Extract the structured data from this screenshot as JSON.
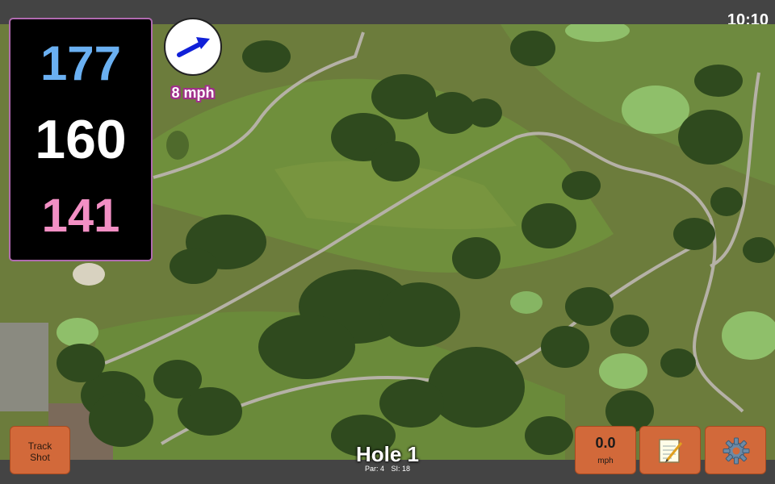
{
  "status": {
    "time": "10:10"
  },
  "distances": {
    "back": "177",
    "middle": "160",
    "front": "141"
  },
  "wind": {
    "speed_label": "8 mph",
    "direction_icon": "arrow-right-icon"
  },
  "hole": {
    "title": "Hole 1",
    "par_label": "Par: 4",
    "si_label": "SI: 18"
  },
  "buttons": {
    "track_shot": [
      "Track",
      "Shot"
    ],
    "speed_value": "0.0",
    "speed_unit": "mph",
    "notes_icon": "notepad-icon",
    "settings_icon": "gear-icon"
  },
  "colors": {
    "back_distance": "#6ab0f2",
    "middle_distance": "#ffffff",
    "front_distance": "#f28fc4",
    "button_bg": "#d2693a",
    "wind_text_outline": "#a0308a",
    "panel_bg": "#000000"
  }
}
